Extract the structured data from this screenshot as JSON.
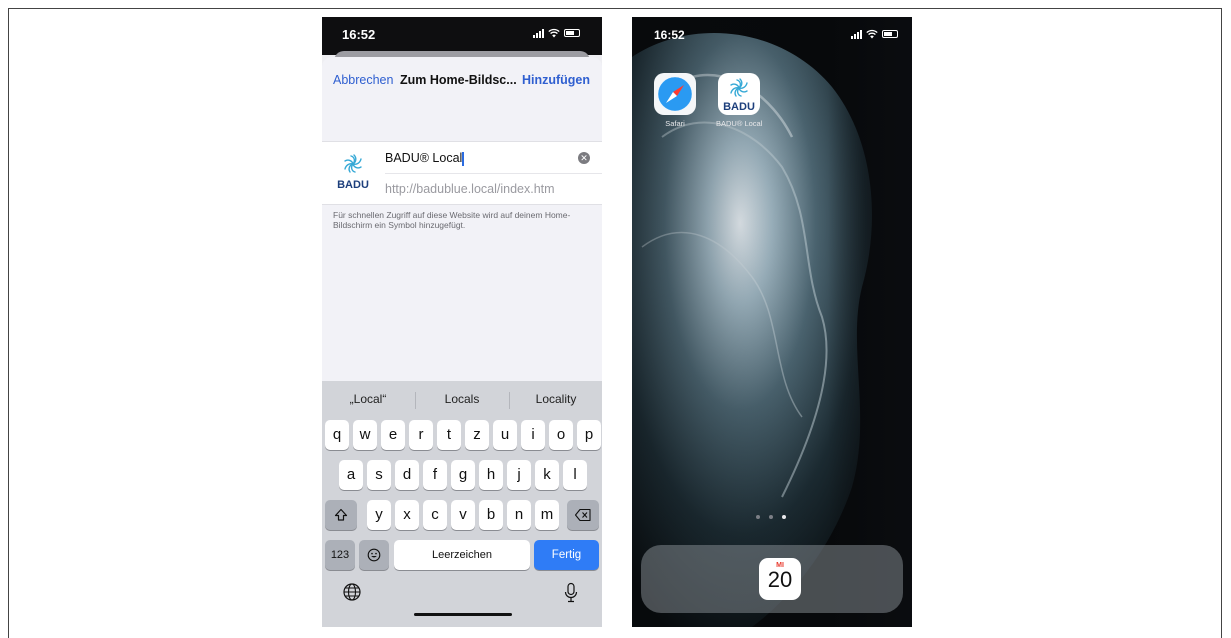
{
  "left_screen": {
    "status_time": "16:52",
    "nav": {
      "cancel": "Abbrechen",
      "title": "Zum Home-Bildsc...",
      "add": "Hinzufügen"
    },
    "app_icon_text": "BADU",
    "name_value": "BADU® Local",
    "url": "http://badublue.local/index.htm",
    "hint": "Für schnellen Zugriff auf diese Website wird auf deinem Home-Bildschirm ein Symbol hinzugefügt.",
    "suggestions": [
      "„Local“",
      "Locals",
      "Locality"
    ],
    "keyboard": {
      "row1": [
        "q",
        "w",
        "e",
        "r",
        "t",
        "z",
        "u",
        "i",
        "o",
        "p"
      ],
      "row2": [
        "a",
        "s",
        "d",
        "f",
        "g",
        "h",
        "j",
        "k",
        "l"
      ],
      "row3": [
        "y",
        "x",
        "c",
        "v",
        "b",
        "n",
        "m"
      ],
      "numbers_key": "123",
      "space_key": "Leerzeichen",
      "return_key": "Fertig"
    }
  },
  "right_screen": {
    "status_time": "16:52",
    "apps": [
      {
        "label": "Safari",
        "icon": "safari-compass-icon"
      },
      {
        "label": "BADU® Local",
        "icon": "badu-logo-icon",
        "tile_text": "BADU"
      }
    ],
    "page_count": 3,
    "active_page": 3,
    "calendar": {
      "weekday": "MI",
      "day": "20"
    }
  },
  "colors": {
    "ios_blue": "#2f5fd0",
    "key_blue": "#2f7cf6",
    "badu_blue": "#1d4f9c",
    "badu_teal": "#36a9d6"
  }
}
